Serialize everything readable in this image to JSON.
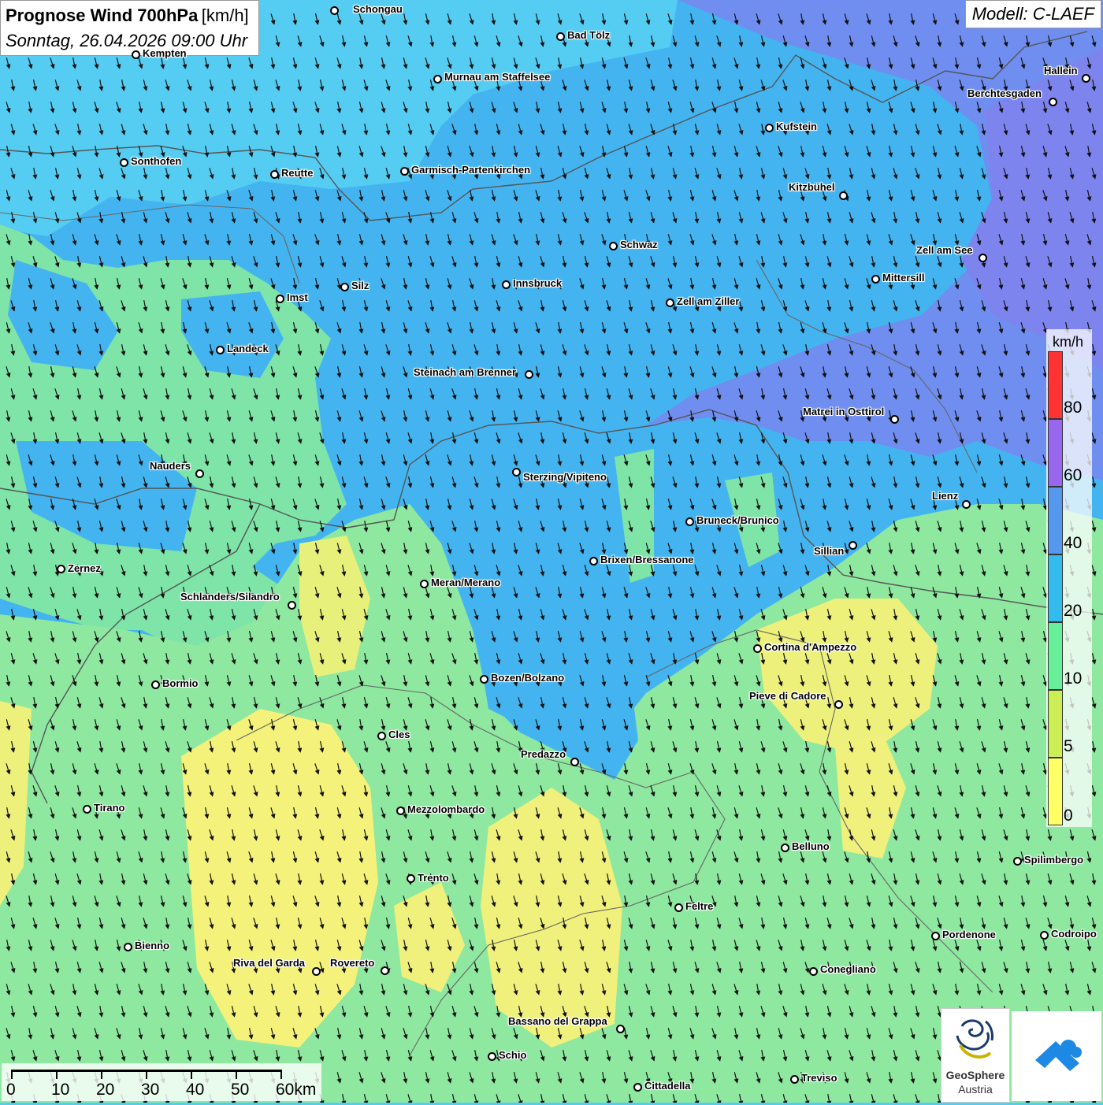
{
  "header": {
    "title": "Prognose Wind 700hPa",
    "unit": "[km/h]",
    "datetime": "Sonntag, 26.04.2026 09:00 Uhr"
  },
  "model": "Modell: C-LAEF",
  "legend": {
    "unit": "km/h",
    "labels": [
      "80",
      "60",
      "40",
      "20",
      "10",
      "5",
      "0"
    ],
    "colors": [
      "#ff3333",
      "#9966ee",
      "#5599ee",
      "#33bbee",
      "#66ee99",
      "#ccee55",
      "#ffff66"
    ]
  },
  "scalebar": {
    "labels": [
      "0",
      "10",
      "20",
      "30",
      "40",
      "50",
      "60km"
    ]
  },
  "wind_direction": "north-northwest to south-southeast",
  "cities": [
    {
      "name": "Schongau"
    },
    {
      "name": "Bad Tölz"
    },
    {
      "name": "Kempten"
    },
    {
      "name": "Murnau am Staffelsee"
    },
    {
      "name": "Hallein"
    },
    {
      "name": "Berchtesgaden"
    },
    {
      "name": "Kufstein"
    },
    {
      "name": "Sonthofen"
    },
    {
      "name": "Reutte"
    },
    {
      "name": "Garmisch-Partenkirchen"
    },
    {
      "name": "Kitzbühel"
    },
    {
      "name": "Schwaz"
    },
    {
      "name": "Zell am See"
    },
    {
      "name": "Mittersill"
    },
    {
      "name": "Innsbruck"
    },
    {
      "name": "Silz"
    },
    {
      "name": "Imst"
    },
    {
      "name": "Zell am Ziller"
    },
    {
      "name": "Landeck"
    },
    {
      "name": "Steinach am Brenner"
    },
    {
      "name": "Matrei in Osttirol"
    },
    {
      "name": "Nauders"
    },
    {
      "name": "Sterzing/Vipiteno"
    },
    {
      "name": "Lienz"
    },
    {
      "name": "Bruneck/Brunico"
    },
    {
      "name": "Sillian"
    },
    {
      "name": "Brixen/Bressanone"
    },
    {
      "name": "Zernez"
    },
    {
      "name": "Meran/Merano"
    },
    {
      "name": "Schlanders/Silandro"
    },
    {
      "name": "Cortina d'Ampezzo"
    },
    {
      "name": "Bozen/Bolzano"
    },
    {
      "name": "Bormio"
    },
    {
      "name": "Pieve di Cadore"
    },
    {
      "name": "Cles"
    },
    {
      "name": "Predazzo"
    },
    {
      "name": "Tirano"
    },
    {
      "name": "Mezzolombardo"
    },
    {
      "name": "Belluno"
    },
    {
      "name": "Spilimbergo"
    },
    {
      "name": "Trento"
    },
    {
      "name": "Feltre"
    },
    {
      "name": "Pordenone"
    },
    {
      "name": "Codroipo"
    },
    {
      "name": "Bienno"
    },
    {
      "name": "Riva del Garda"
    },
    {
      "name": "Rovereto"
    },
    {
      "name": "Conegliano"
    },
    {
      "name": "Bassano del Grappa"
    },
    {
      "name": "Schio"
    },
    {
      "name": "Treviso"
    },
    {
      "name": "Cittadella"
    }
  ],
  "logos": {
    "geosphere_name": "GeoSphere",
    "geosphere_sub": "Austria"
  }
}
